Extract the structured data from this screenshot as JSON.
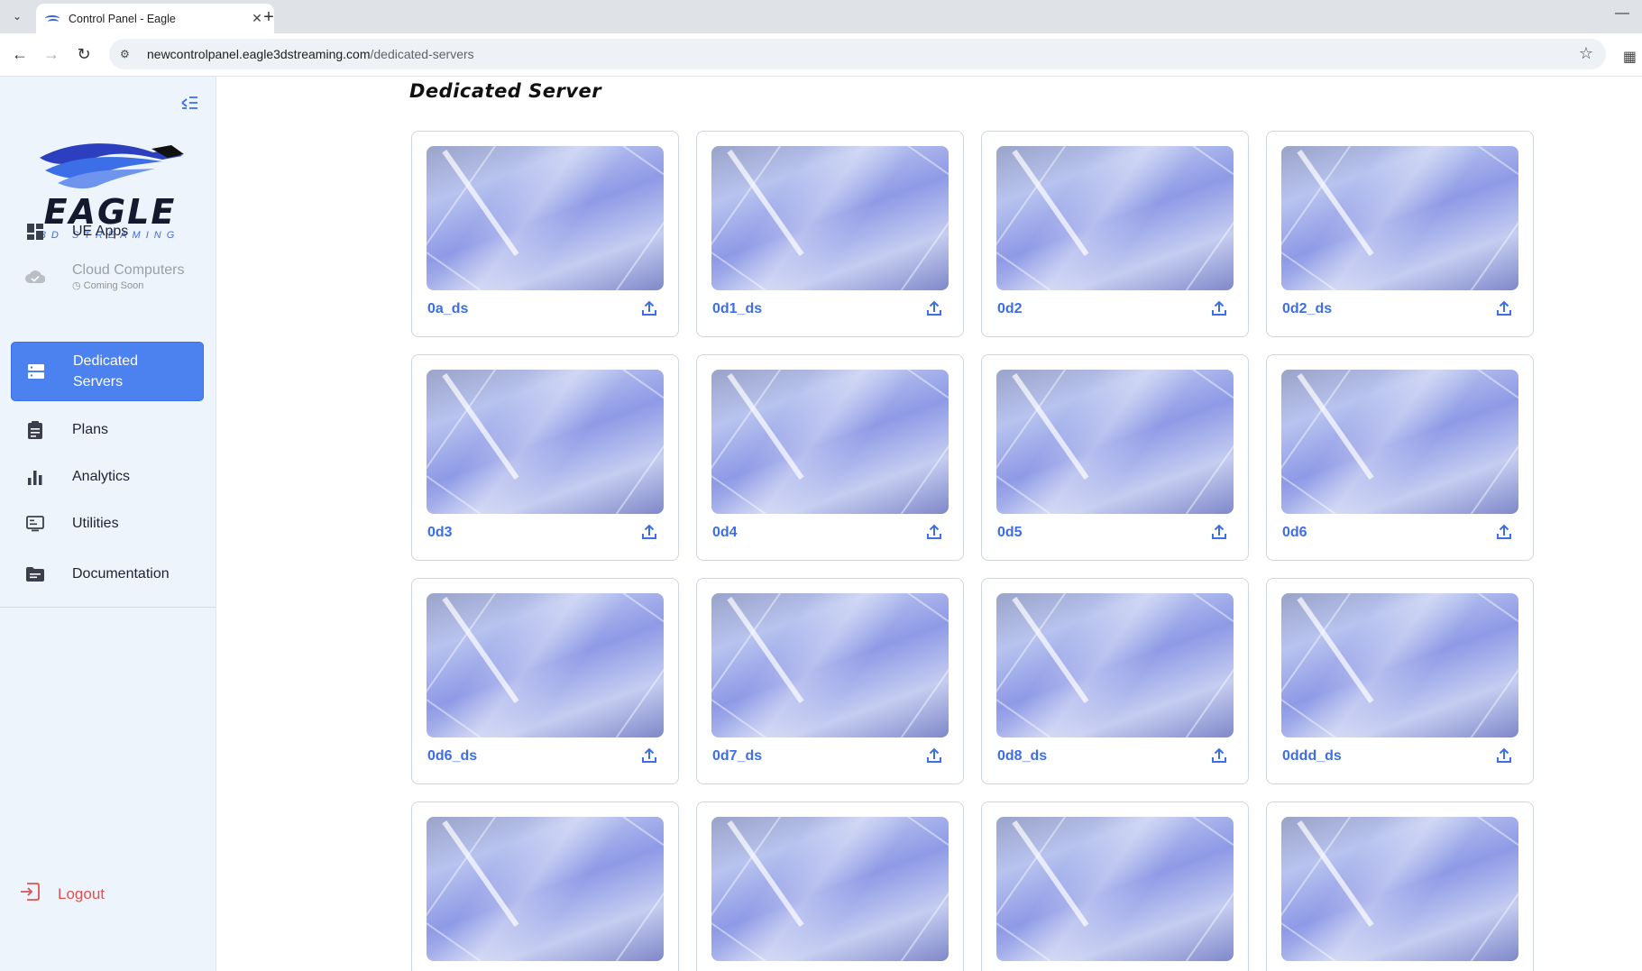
{
  "browser": {
    "tab_title": "Control Panel - Eagle",
    "url_host": "newcontrolpanel.eagle3dstreaming.com",
    "url_path": "/dedicated-servers"
  },
  "brand": {
    "name": "EAGLE",
    "tagline": "3D STREAMING",
    "accent": "#3c6ee8"
  },
  "sidebar": {
    "items": [
      {
        "label": "UE Apps",
        "icon": "dashboard-icon"
      },
      {
        "label": "Cloud Computers",
        "sub": "Coming Soon",
        "icon": "cloud-icon"
      },
      {
        "label": "Dedicated Servers",
        "icon": "server-icon"
      },
      {
        "label": "Plans",
        "icon": "clipboard-icon"
      },
      {
        "label": "Analytics",
        "icon": "bar-chart-icon"
      },
      {
        "label": "Utilities",
        "icon": "utilities-icon"
      },
      {
        "label": "Documentation",
        "icon": "folder-icon"
      }
    ],
    "logout": "Logout"
  },
  "main": {
    "title": "Dedicated Server",
    "cards": [
      {
        "label": "0a_ds"
      },
      {
        "label": "0d1_ds"
      },
      {
        "label": "0d2"
      },
      {
        "label": "0d2_ds"
      },
      {
        "label": "0d3"
      },
      {
        "label": "0d4"
      },
      {
        "label": "0d5"
      },
      {
        "label": "0d6"
      },
      {
        "label": "0d6_ds"
      },
      {
        "label": "0d7_ds"
      },
      {
        "label": "0d8_ds"
      },
      {
        "label": "0ddd_ds"
      },
      {
        "label": ""
      },
      {
        "label": ""
      },
      {
        "label": ""
      },
      {
        "label": ""
      }
    ]
  }
}
